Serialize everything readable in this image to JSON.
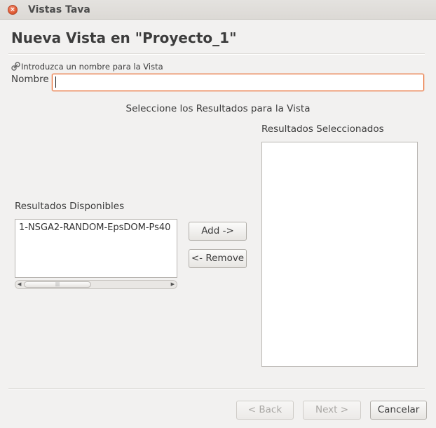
{
  "window": {
    "title": "Vistas Tava",
    "close_symbol": "×"
  },
  "page": {
    "title": "Nueva Vista en \"Proyecto_1\""
  },
  "hint": {
    "text": "Introduzca un nombre para la Vista",
    "icon": "link-icon"
  },
  "name_field": {
    "label": "Nombre",
    "value": "",
    "placeholder": ""
  },
  "selection": {
    "heading": "Seleccione los Resultados para la Vista",
    "available_label": "Resultados Disponibles",
    "available_items": [
      "1-NSGA2-RANDOM-EpsDOM-Ps40"
    ],
    "selected_label": "Resultados Seleccionados",
    "selected_items": [],
    "add_label": "Add ->",
    "remove_label": "<- Remove",
    "scroll_grip": "|||"
  },
  "footer": {
    "back_label": "< Back",
    "next_label": "Next >",
    "cancel_label": "Cancelar"
  },
  "colors": {
    "accent": "#e7672a",
    "close": "#e05a33",
    "background": "#f2f1f0"
  }
}
